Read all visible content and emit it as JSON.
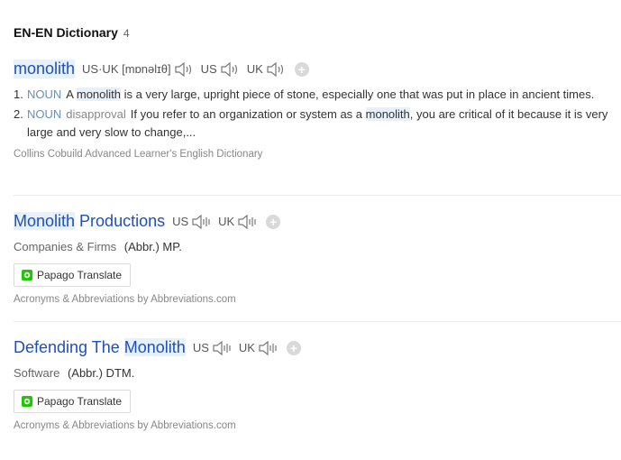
{
  "header": {
    "title": "EN-EN Dictionary",
    "count": "4"
  },
  "entry1": {
    "headword": "monolith",
    "pron_label": "US·UK",
    "pron": "[mɒnəlɪθ]",
    "us_label": "US",
    "uk_label": "UK",
    "defs": [
      {
        "num": "1.",
        "pos": "NOUN",
        "text_a": "A ",
        "hl": "monolith",
        "text_b": " is a very large, upright piece of stone, especially one that was put in place in ancient times."
      },
      {
        "num": "2.",
        "pos": "NOUN",
        "usage": "disapproval",
        "text_a": "If you refer to an organization or system as a ",
        "hl": "monolith",
        "text_b": ", you are critical of it because it is very large and very slow to change,..."
      }
    ],
    "source": "Collins Cobuild Advanced Learner's English Dictionary"
  },
  "entry2": {
    "headword_hl": "Monolith",
    "headword_rest": " Productions",
    "us_label": "US",
    "uk_label": "UK",
    "category": "Companies & Firms",
    "abbr": "(Abbr.) MP.",
    "papago": "Papago Translate",
    "source": "Acronyms & Abbreviations by Abbreviations.com"
  },
  "entry3": {
    "headword_pre": "Defending The ",
    "headword_hl": "Monolith",
    "us_label": "US",
    "uk_label": "UK",
    "category": "Software",
    "abbr": "(Abbr.) DTM.",
    "papago": "Papago Translate",
    "source": "Acronyms & Abbreviations by Abbreviations.com"
  },
  "icons": {
    "speaker": "speaker-icon",
    "add": "add-icon",
    "papago": "papago-logo-icon"
  },
  "colors": {
    "link": "#1f4fbf",
    "highlight": "#e6f1fb",
    "pos": "#6b8fb3"
  }
}
